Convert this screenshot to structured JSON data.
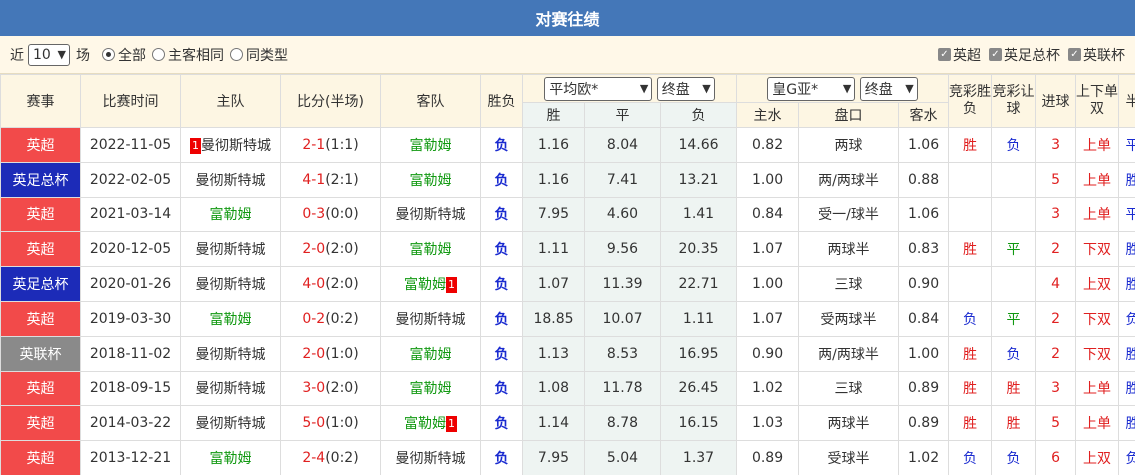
{
  "title": "对赛往绩",
  "filter": {
    "near_label": "近",
    "count_value": "10",
    "field_label": "场",
    "options": [
      {
        "label": "全部",
        "selected": true
      },
      {
        "label": "主客相同",
        "selected": false
      },
      {
        "label": "同类型",
        "selected": false
      }
    ],
    "checkboxes": [
      {
        "label": "英超",
        "checked": true
      },
      {
        "label": "英足总杯",
        "checked": true
      },
      {
        "label": "英联杯",
        "checked": true
      }
    ]
  },
  "headers": {
    "competition": "赛事",
    "date": "比赛时间",
    "home": "主队",
    "score": "比分(半场)",
    "away": "客队",
    "result": "胜负",
    "euro_select": "平均欧*",
    "euro_period": "终盘",
    "asia_select": "皇G亚*",
    "asia_period": "终盘",
    "lottery_wdl": "竞彩胜负",
    "lottery_handicap": "竞彩让球",
    "goals": "进球",
    "odd_even": "上下单双",
    "half_full": "半全",
    "win": "胜",
    "draw": "平",
    "lose": "负",
    "home_water": "主水",
    "handicap": "盘口",
    "away_water": "客水"
  },
  "rows": [
    {
      "comp": "英超",
      "comp_type": "yc",
      "date": "2022-11-05",
      "home": "曼彻斯特城",
      "home_card": "1",
      "home_green": false,
      "score": "2-1",
      "ht": "(1:1)",
      "away": "富勒姆",
      "away_card": "",
      "away_green": true,
      "result": "负",
      "w": "1.16",
      "d": "8.04",
      "l": "14.66",
      "hw": "0.82",
      "line": "两球",
      "aw": "1.06",
      "lw": "胜",
      "lh": "负",
      "goals": "3",
      "oe": "上单",
      "hf": "平胜"
    },
    {
      "comp": "英足总杯",
      "comp_type": "fa",
      "date": "2022-02-05",
      "home": "曼彻斯特城",
      "home_card": "",
      "home_green": false,
      "score": "4-1",
      "ht": "(2:1)",
      "away": "富勒姆",
      "away_card": "",
      "away_green": true,
      "result": "负",
      "w": "1.16",
      "d": "7.41",
      "l": "13.21",
      "hw": "1.00",
      "line": "两/两球半",
      "aw": "0.88",
      "lw": "",
      "lh": "",
      "goals": "5",
      "oe": "上单",
      "hf": "胜胜"
    },
    {
      "comp": "英超",
      "comp_type": "yc",
      "date": "2021-03-14",
      "home": "富勒姆",
      "home_card": "",
      "home_green": true,
      "score": "0-3",
      "ht": "(0:0)",
      "away": "曼彻斯特城",
      "away_card": "",
      "away_green": false,
      "result": "负",
      "w": "7.95",
      "d": "4.60",
      "l": "1.41",
      "hw": "0.84",
      "line": "受一/球半",
      "aw": "1.06",
      "lw": "",
      "lh": "",
      "goals": "3",
      "oe": "上单",
      "hf": "平负"
    },
    {
      "comp": "英超",
      "comp_type": "yc",
      "date": "2020-12-05",
      "home": "曼彻斯特城",
      "home_card": "",
      "home_green": false,
      "score": "2-0",
      "ht": "(2:0)",
      "away": "富勒姆",
      "away_card": "",
      "away_green": true,
      "result": "负",
      "w": "1.11",
      "d": "9.56",
      "l": "20.35",
      "hw": "1.07",
      "line": "两球半",
      "aw": "0.83",
      "lw": "胜",
      "lh": "平",
      "goals": "2",
      "oe": "下双",
      "hf": "胜胜"
    },
    {
      "comp": "英足总杯",
      "comp_type": "fa",
      "date": "2020-01-26",
      "home": "曼彻斯特城",
      "home_card": "",
      "home_green": false,
      "score": "4-0",
      "ht": "(2:0)",
      "away": "富勒姆",
      "away_card": "1",
      "away_green": true,
      "result": "负",
      "w": "1.07",
      "d": "11.39",
      "l": "22.71",
      "hw": "1.00",
      "line": "三球",
      "aw": "0.90",
      "lw": "",
      "lh": "",
      "goals": "4",
      "oe": "上双",
      "hf": "胜胜"
    },
    {
      "comp": "英超",
      "comp_type": "yc",
      "date": "2019-03-30",
      "home": "富勒姆",
      "home_card": "",
      "home_green": true,
      "score": "0-2",
      "ht": "(0:2)",
      "away": "曼彻斯特城",
      "away_card": "",
      "away_green": false,
      "result": "负",
      "w": "18.85",
      "d": "10.07",
      "l": "1.11",
      "hw": "1.07",
      "line": "受两球半",
      "aw": "0.84",
      "lw": "负",
      "lh": "平",
      "goals": "2",
      "oe": "下双",
      "hf": "负负"
    },
    {
      "comp": "英联杯",
      "comp_type": "lc",
      "date": "2018-11-02",
      "home": "曼彻斯特城",
      "home_card": "",
      "home_green": false,
      "score": "2-0",
      "ht": "(1:0)",
      "away": "富勒姆",
      "away_card": "",
      "away_green": true,
      "result": "负",
      "w": "1.13",
      "d": "8.53",
      "l": "16.95",
      "hw": "0.90",
      "line": "两/两球半",
      "aw": "1.00",
      "lw": "胜",
      "lh": "负",
      "goals": "2",
      "oe": "下双",
      "hf": "胜胜"
    },
    {
      "comp": "英超",
      "comp_type": "yc",
      "date": "2018-09-15",
      "home": "曼彻斯特城",
      "home_card": "",
      "home_green": false,
      "score": "3-0",
      "ht": "(2:0)",
      "away": "富勒姆",
      "away_card": "",
      "away_green": true,
      "result": "负",
      "w": "1.08",
      "d": "11.78",
      "l": "26.45",
      "hw": "1.02",
      "line": "三球",
      "aw": "0.89",
      "lw": "胜",
      "lh": "胜",
      "goals": "3",
      "oe": "上单",
      "hf": "胜胜"
    },
    {
      "comp": "英超",
      "comp_type": "yc",
      "date": "2014-03-22",
      "home": "曼彻斯特城",
      "home_card": "",
      "home_green": false,
      "score": "5-0",
      "ht": "(1:0)",
      "away": "富勒姆",
      "away_card": "1",
      "away_green": true,
      "result": "负",
      "w": "1.14",
      "d": "8.78",
      "l": "16.15",
      "hw": "1.03",
      "line": "两球半",
      "aw": "0.89",
      "lw": "胜",
      "lh": "胜",
      "goals": "5",
      "oe": "上单",
      "hf": "胜胜"
    },
    {
      "comp": "英超",
      "comp_type": "yc",
      "date": "2013-12-21",
      "home": "富勒姆",
      "home_card": "",
      "home_green": true,
      "score": "2-4",
      "ht": "(0:2)",
      "away": "曼彻斯特城",
      "away_card": "",
      "away_green": false,
      "result": "负",
      "w": "7.95",
      "d": "5.04",
      "l": "1.37",
      "hw": "0.89",
      "line": "受球半",
      "aw": "1.02",
      "lw": "负",
      "lh": "负",
      "goals": "6",
      "oe": "上双",
      "hf": "负负"
    }
  ],
  "colors": {
    "title_bg": "#4477b8",
    "premier_league": "#f24a4a",
    "fa_cup": "#1c2bb8",
    "league_cup": "#8a8a8a",
    "team_green": "#119911",
    "red_text": "#e02020",
    "blue_text": "#1a2bd0"
  }
}
